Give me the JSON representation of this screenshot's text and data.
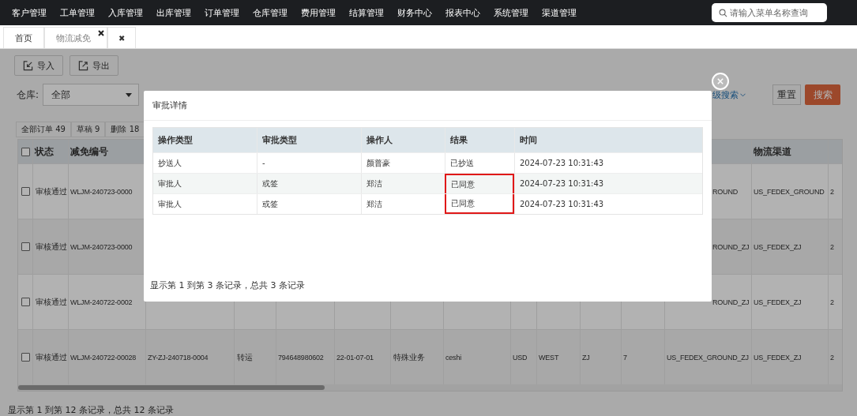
{
  "nav": {
    "items": [
      "客户管理",
      "工单管理",
      "入库管理",
      "出库管理",
      "订单管理",
      "仓库管理",
      "费用管理",
      "结算管理",
      "财务中心",
      "报表中心",
      "系统管理",
      "渠道管理"
    ],
    "search": {
      "placeholder": "请输入菜单名称查询"
    }
  },
  "tabs": [
    {
      "label": "首页",
      "selected": false,
      "closable": false
    },
    {
      "label": "物流减免",
      "selected": true,
      "closable": true
    }
  ],
  "close_all": "✖",
  "toolbar": [
    {
      "label": "导入",
      "kind": "import"
    },
    {
      "label": "导出",
      "kind": "export"
    }
  ],
  "filters": {
    "warehouse_label": "仓库:",
    "warehouse_value": "全部",
    "advanced": "级搜索",
    "reset": "重置",
    "search": "搜索"
  },
  "counts": [
    "全部订单 49",
    "草稿 9",
    "删除 18"
  ],
  "table": {
    "all_checked": false,
    "header": {
      "status": "状态",
      "reduction_no": "减免编号",
      "logistics_channel": "物流渠道"
    },
    "rows": [
      {
        "checked": false,
        "cells": {
          "status": "审核通过",
          "reduction_no": "WLJM-240723-0000",
          "column_13": "ROUND",
          "logistics_channel": "US_FEDEX_GROUND",
          "column_15": "2"
        }
      },
      {
        "checked": false,
        "cells": {
          "status": "审核通过",
          "reduction_no": "WLJM-240723-0000",
          "column_13": "ROUND_ZJ",
          "logistics_channel": "US_FEDEX_ZJ",
          "column_15": "2"
        }
      },
      {
        "checked": false,
        "cells": {
          "status": "审核通过",
          "reduction_no": "WLJM-240722-0002",
          "column_13": "ROUND_ZJ",
          "logistics_channel": "US_FEDEX_ZJ",
          "column_15": "2"
        }
      },
      {
        "checked": false,
        "cells": {
          "status": "审核通过",
          "reduction_no": "WLJM-240722-00028",
          "column_3": "ZY-ZJ-240718-0004",
          "column_4": "转运",
          "column_5": "794648980602",
          "column_6": "22-01-07-01",
          "column_7": "特殊业务",
          "column_8": "ceshi",
          "column_9": "USD",
          "column_10": "WEST",
          "column_11": "ZJ",
          "column_12": "7",
          "column_13": "US_FEDEX_GROUND_ZJ",
          "logistics_channel": "US_FEDEX_ZJ",
          "column_15": "2"
        }
      }
    ]
  },
  "footer": "显示第 1 到第 12 条记录，总共 12 条记录",
  "dialog": {
    "title": "审批详情",
    "columns": [
      "操作类型",
      "审批类型",
      "操作人",
      "结果",
      "时间"
    ],
    "rows": [
      {
        "cells": [
          "抄送人",
          "-",
          "颜普豪",
          "已抄送",
          "2024-07-23 10:31:43"
        ],
        "highlighted": false
      },
      {
        "cells": [
          "审批人",
          "或签",
          "郑洁",
          "已同意",
          "2024-07-23 10:31:43"
        ],
        "highlighted": true
      },
      {
        "cells": [
          "审批人",
          "或签",
          "郑洁",
          "已同意",
          "2024-07-23 10:31:43"
        ],
        "highlighted": true
      }
    ],
    "footer": "显示第 1 到第 3 条记录，总共 3 条记录"
  }
}
